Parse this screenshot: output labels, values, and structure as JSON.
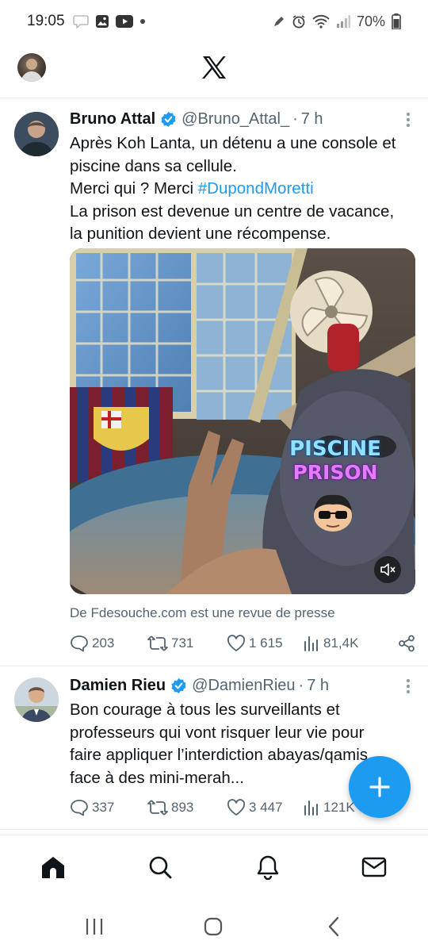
{
  "status_bar": {
    "time": "19:05",
    "battery": "70%"
  },
  "header": {
    "logo": "X"
  },
  "tweets": [
    {
      "author_name": "Bruno Attal",
      "handle": "@Bruno_Attal_",
      "dot": "·",
      "time": "7 h",
      "lines": [
        "Après Koh Lanta, un détenu a une console et",
        "piscine dans sa cellule.",
        "Merci qui ? Merci ",
        "La prison est devenue un centre de vacance,",
        "la punition devient une récompense."
      ],
      "hashtag": "#DupondMoretti",
      "media_overlay": {
        "line1": "PISCINE",
        "line2": "PRISON"
      },
      "caption": "De Fdesouche.com est une revue de presse",
      "replies": "203",
      "retweets": "731",
      "likes": "1 615",
      "views": "81,4K"
    },
    {
      "author_name": "Damien Rieu",
      "handle": "@DamienRieu",
      "dot": "·",
      "time": "7 h",
      "lines": [
        "Bon courage à tous les surveillants et",
        "professeurs qui vont risquer leur vie pour",
        "faire appliquer l’interdiction abayas/qamis",
        "face à des mini-merah..."
      ],
      "replies": "337",
      "retweets": "893",
      "likes": "3 447",
      "views": "121K"
    }
  ],
  "colors": {
    "accent": "#1d9bf0",
    "text": "#0f1419",
    "muted": "#536471"
  },
  "icons": [
    "home-icon",
    "search-icon",
    "notifications-icon",
    "messages-icon",
    "compose-icon"
  ]
}
